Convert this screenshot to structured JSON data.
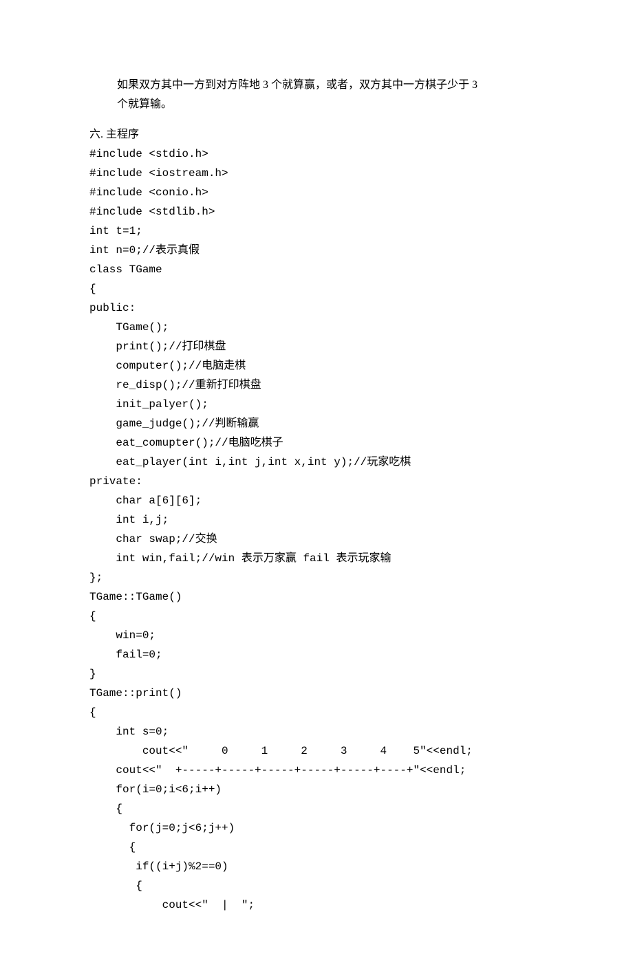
{
  "intro": {
    "line1": "如果双方其中一方到对方阵地 3 个就算赢，或者，双方其中一方棋子少于 3",
    "line2": "个就算输。"
  },
  "section_title": "六. 主程序",
  "code_lines": [
    "#include <stdio.h>",
    "#include <iostream.h>",
    "#include <conio.h>",
    "#include <stdlib.h>",
    "int t=1;",
    "int n=0;//表示真假",
    "class TGame",
    "{",
    "public:",
    "    TGame();",
    "    print();//打印棋盘",
    "    computer();//电脑走棋",
    "    re_disp();//重新打印棋盘",
    "    init_palyer();",
    "    game_judge();//判断输赢",
    "    eat_comupter();//电脑吃棋子",
    "    eat_player(int i,int j,int x,int y);//玩家吃棋",
    "private:",
    "    char a[6][6];",
    "    int i,j;",
    "    char swap;//交换",
    "    int win,fail;//win 表示万家赢 fail 表示玩家输",
    "};",
    "TGame::TGame()",
    "{",
    "    win=0;",
    "    fail=0;",
    "}",
    "TGame::print()",
    "{",
    "    int s=0;",
    "        cout<<\"     0     1     2     3     4    5\"<<endl;",
    "    cout<<\"  +-----+-----+-----+-----+-----+----+\"<<endl;",
    "    for(i=0;i<6;i++)",
    "    {",
    "      for(j=0;j<6;j++)",
    "      {",
    "       if((i+j)%2==0)",
    "       {",
    "           cout<<\"  |  \";"
  ]
}
